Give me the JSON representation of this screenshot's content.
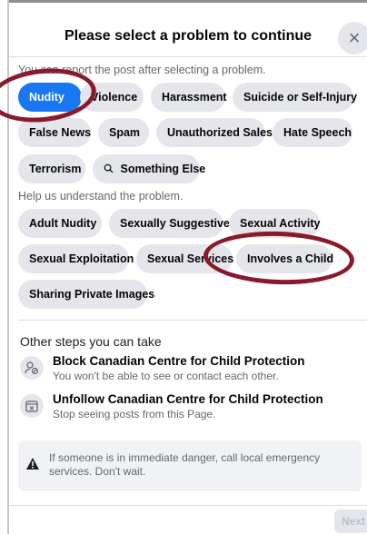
{
  "dialog": {
    "title": "Please select a problem to continue",
    "close_glyph": "×"
  },
  "problems": {
    "hint": "You can report the post after selecting a problem.",
    "options": [
      {
        "label": "Nudity",
        "selected": true
      },
      {
        "label": "Violence",
        "selected": false
      },
      {
        "label": "Harassment",
        "selected": false
      },
      {
        "label": "Suicide or Self-Injury",
        "selected": false
      },
      {
        "label": "False News",
        "selected": false
      },
      {
        "label": "Spam",
        "selected": false
      },
      {
        "label": "Unauthorized Sales",
        "selected": false
      },
      {
        "label": "Hate Speech",
        "selected": false
      },
      {
        "label": "Terrorism",
        "selected": false
      },
      {
        "label": "Something Else",
        "selected": false,
        "icon": "search-icon"
      }
    ]
  },
  "subproblems": {
    "hint": "Help us understand the problem.",
    "options": [
      {
        "label": "Adult Nudity"
      },
      {
        "label": "Sexually Suggestive"
      },
      {
        "label": "Sexual Activity"
      },
      {
        "label": "Sexual Exploitation"
      },
      {
        "label": "Sexual Services"
      },
      {
        "label": "Involves a Child"
      },
      {
        "label": "Sharing Private Images"
      }
    ]
  },
  "other_steps": {
    "title": "Other steps you can take",
    "items": [
      {
        "title": "Block Canadian Centre for Child Protection",
        "subtitle": "You won't be able to see or contact each other.",
        "icon": "block-user-icon"
      },
      {
        "title": "Unfollow Canadian Centre for Child Protection",
        "subtitle": "Stop seeing posts from this Page.",
        "icon": "unfollow-icon"
      }
    ]
  },
  "warning": {
    "icon": "warning-icon",
    "text": "If someone is in immediate danger, call local emergency services. Don't wait."
  },
  "footer": {
    "next_label": "Next"
  },
  "colors": {
    "accent": "#1877f2",
    "annotation_ring": "#8a1a2b"
  }
}
